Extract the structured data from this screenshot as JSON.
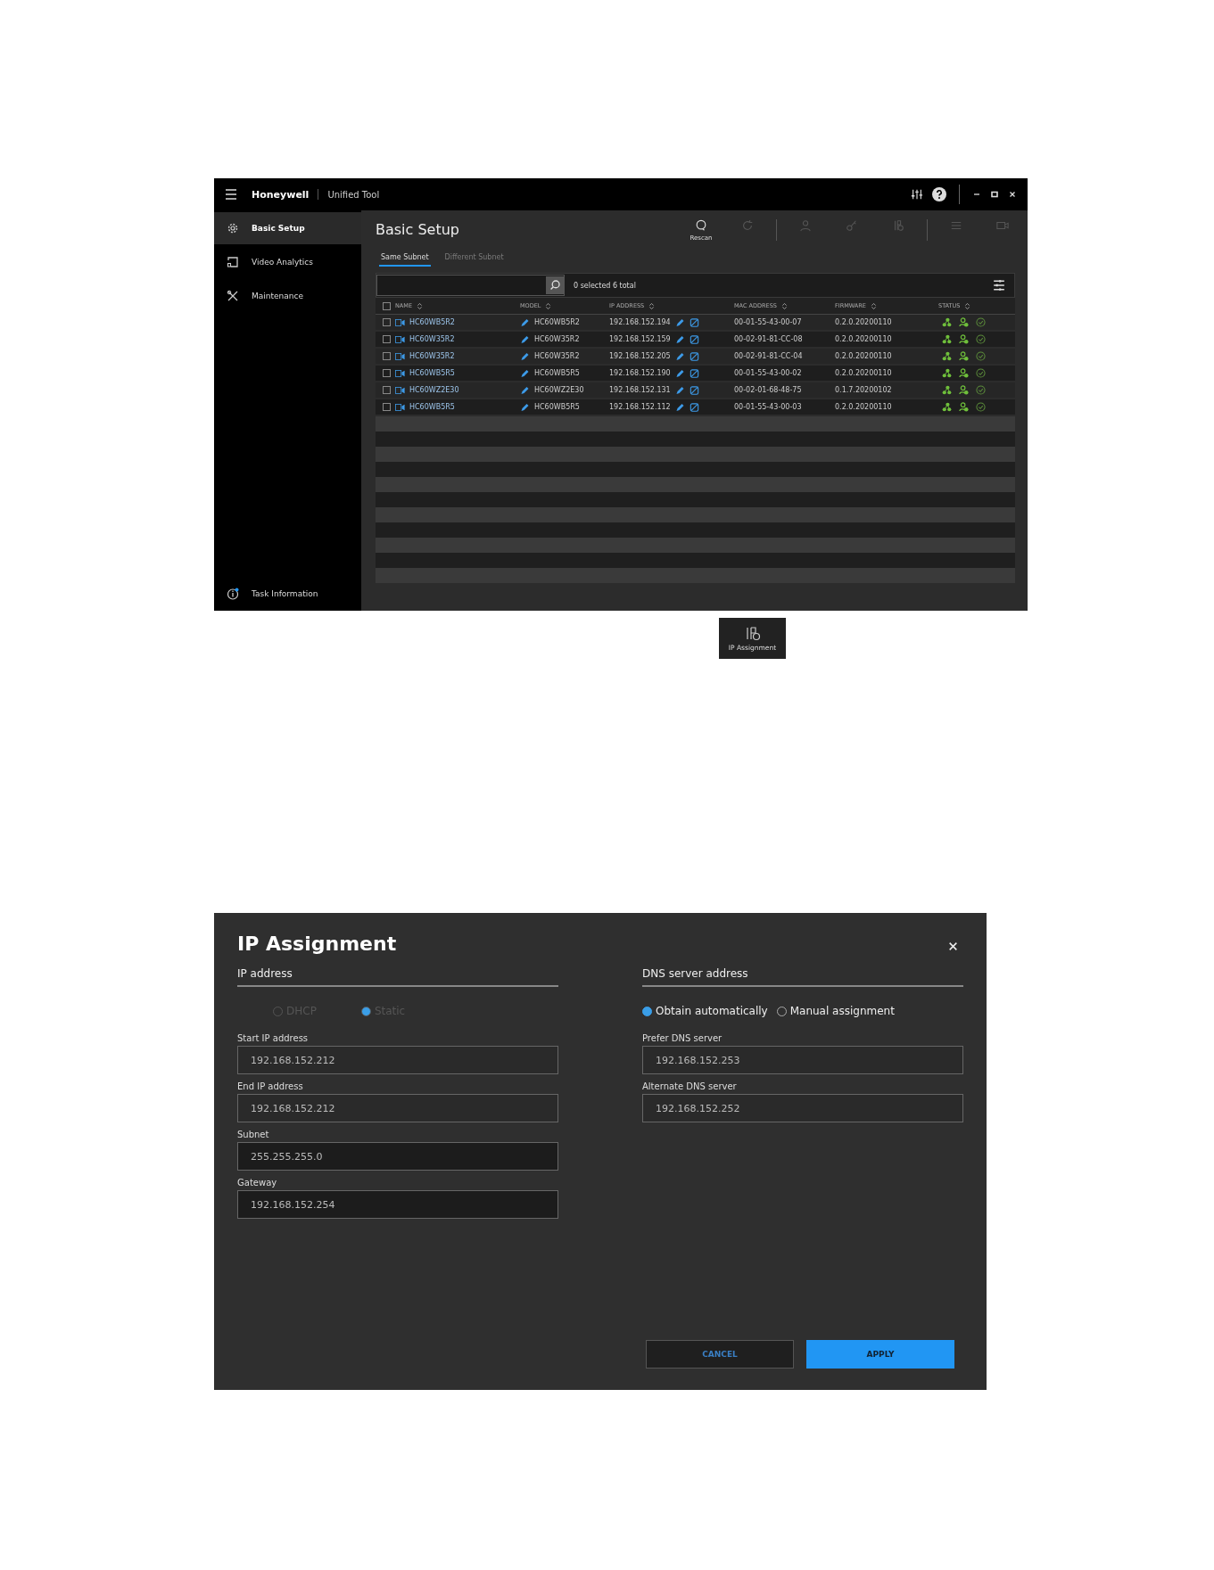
{
  "app": {
    "brand": "Honeywell",
    "title": "Unified Tool"
  },
  "sidebar": {
    "items": [
      {
        "label": "Basic Setup",
        "selected": true
      },
      {
        "label": "Video Analytics",
        "selected": false
      },
      {
        "label": "Maintenance",
        "selected": false
      }
    ],
    "footer": {
      "label": "Task Information"
    }
  },
  "page": {
    "title": "Basic Setup"
  },
  "toolbar": [
    {
      "label": "Rescan",
      "disabled": false
    },
    {
      "disabled": true
    },
    {
      "disabled": true
    },
    {
      "disabled": true
    },
    {
      "disabled": true
    },
    {
      "disabled": true
    },
    {
      "disabled": true
    }
  ],
  "tabs": [
    {
      "label": "Same Subnet",
      "selected": true
    },
    {
      "label": "Different Subnet",
      "selected": false
    }
  ],
  "selection_summary": "0 selected 6 total",
  "table": {
    "select_all_checked": false,
    "columns": [
      "NAME",
      "MODEL",
      "IP ADDRESS",
      "MAC ADDRESS",
      "FIRMWARE",
      "STATUS"
    ],
    "rows": [
      {
        "checked": false,
        "name": "HC60WB5R2",
        "model": "HC60WB5R2",
        "ip": "192.168.152.194",
        "mac": "00-01-55-43-00-07",
        "firmware": "0.2.0.20200110"
      },
      {
        "checked": false,
        "name": "HC60W35R2",
        "model": "HC60W35R2",
        "ip": "192.168.152.159",
        "mac": "00-02-91-81-CC-08",
        "firmware": "0.2.0.20200110"
      },
      {
        "checked": false,
        "name": "HC60W35R2",
        "model": "HC60W35R2",
        "ip": "192.168.152.205",
        "mac": "00-02-91-81-CC-04",
        "firmware": "0.2.0.20200110"
      },
      {
        "checked": false,
        "name": "HC60WB5R5",
        "model": "HC60WB5R5",
        "ip": "192.168.152.190",
        "mac": "00-01-55-43-00-02",
        "firmware": "0.2.0.20200110"
      },
      {
        "checked": false,
        "name": "HC60WZ2E30",
        "model": "HC60WZ2E30",
        "ip": "192.168.152.131",
        "mac": "00-02-01-68-48-75",
        "firmware": "0.1.7.20200102"
      },
      {
        "checked": false,
        "name": "HC60WB5R5",
        "model": "HC60WB5R5",
        "ip": "192.168.152.112",
        "mac": "00-01-55-43-00-03",
        "firmware": "0.2.0.20200110"
      }
    ]
  },
  "ip_assignment_button": {
    "label": "IP Assignment"
  },
  "dialog": {
    "title": "IP Assignment",
    "sections": [
      {
        "heading": "IP address",
        "radios_disabled": true,
        "radios": [
          {
            "label": "DHCP",
            "selected": false
          },
          {
            "label": "Static",
            "selected": true
          }
        ],
        "fields": [
          {
            "label": "Start IP address",
            "value": "192.168.152.212"
          },
          {
            "label": "End IP address",
            "value": "192.168.152.212"
          },
          {
            "label": "Subnet",
            "value": "255.255.255.0"
          },
          {
            "label": "Gateway",
            "value": "192.168.152.254"
          }
        ]
      },
      {
        "heading": "DNS server address",
        "radios_disabled": false,
        "radios": [
          {
            "label": "Obtain automatically",
            "selected": true
          },
          {
            "label": "Manual assignment",
            "selected": false
          }
        ],
        "fields": [
          {
            "label": "Prefer DNS server",
            "value": "192.168.152.253"
          },
          {
            "label": "Alternate DNS server",
            "value": "192.168.152.252"
          }
        ]
      }
    ],
    "buttons": [
      {
        "label": "CANCEL",
        "kind": "secondary"
      },
      {
        "label": "APPLY",
        "kind": "primary"
      }
    ]
  }
}
